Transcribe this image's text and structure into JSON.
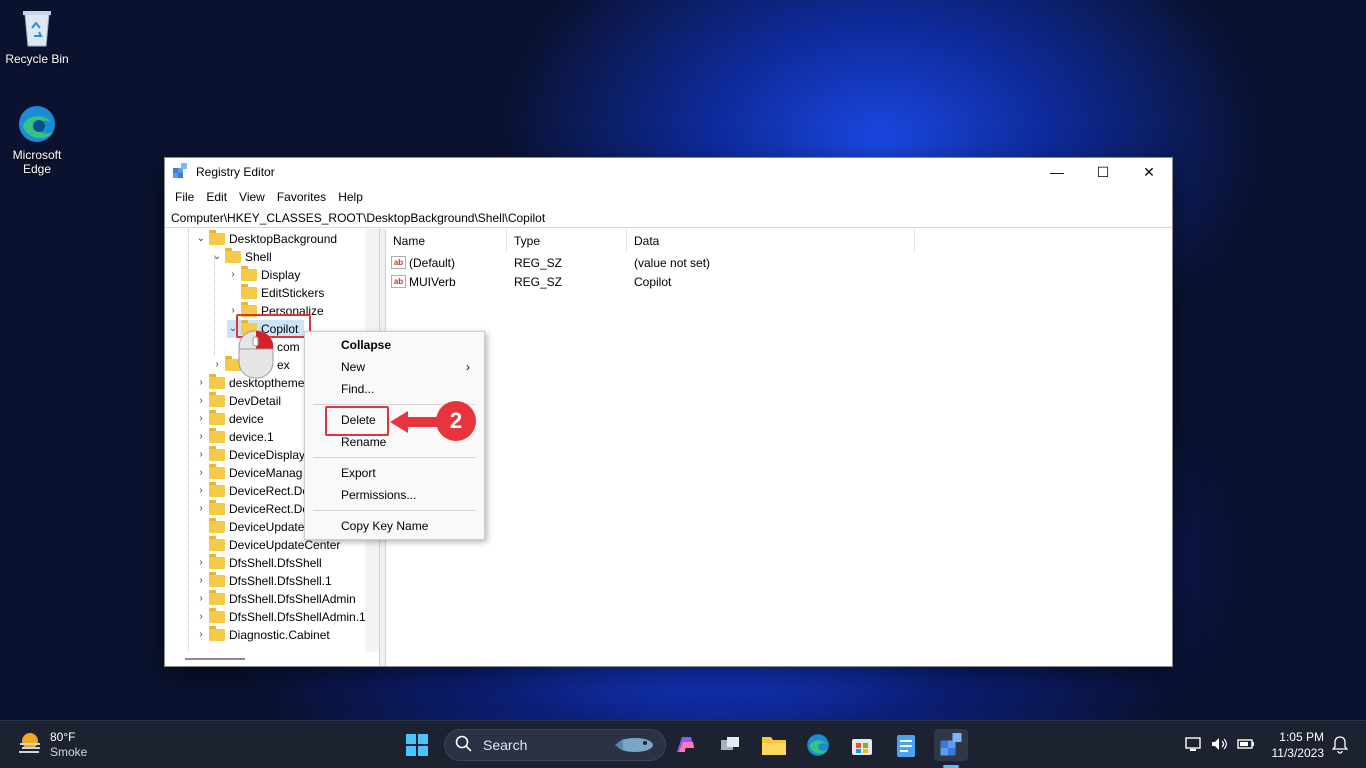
{
  "desktop": {
    "icons": [
      {
        "label": "Recycle Bin"
      },
      {
        "label": "Microsoft Edge"
      }
    ]
  },
  "window": {
    "title": "Registry Editor",
    "controls": {
      "minimize": "—",
      "maximize": "☐",
      "close": "✕"
    },
    "menu": [
      "File",
      "Edit",
      "View",
      "Favorites",
      "Help"
    ],
    "address": "Computer\\HKEY_CLASSES_ROOT\\DesktopBackground\\Shell\\Copilot"
  },
  "tree": {
    "nodes": [
      {
        "label": "DesktopBackground",
        "exp": "⌄"
      },
      {
        "label": "Shell",
        "exp": "⌄"
      },
      {
        "label": "Display",
        "exp": "›"
      },
      {
        "label": "EditStickers",
        "exp": ""
      },
      {
        "label": "Personalize",
        "exp": "›"
      },
      {
        "label": "Copilot",
        "exp": "⌄"
      },
      {
        "label": "com",
        "exp": ""
      },
      {
        "label": "ex",
        "exp": "›"
      },
      {
        "label": "desktopthemes",
        "exp": "›"
      },
      {
        "label": "DevDetail",
        "exp": "›"
      },
      {
        "label": "device",
        "exp": "›"
      },
      {
        "label": "device.1",
        "exp": "›"
      },
      {
        "label": "DeviceDisplay",
        "exp": "›"
      },
      {
        "label": "DeviceManag",
        "exp": "›"
      },
      {
        "label": "DeviceRect.De",
        "exp": "›"
      },
      {
        "label": "DeviceRect.De",
        "exp": "›"
      },
      {
        "label": "DeviceUpdate",
        "exp": ""
      },
      {
        "label": "DeviceUpdateCenter",
        "exp": ""
      },
      {
        "label": "DfsShell.DfsShell",
        "exp": "›"
      },
      {
        "label": "DfsShell.DfsShell.1",
        "exp": "›"
      },
      {
        "label": "DfsShell.DfsShellAdmin",
        "exp": "›"
      },
      {
        "label": "DfsShell.DfsShellAdmin.1",
        "exp": "›"
      },
      {
        "label": "Diagnostic.Cabinet",
        "exp": "›"
      }
    ]
  },
  "values": {
    "headers": [
      "Name",
      "Type",
      "Data"
    ],
    "rows": [
      {
        "name": "(Default)",
        "type": "REG_SZ",
        "data": "(value not set)"
      },
      {
        "name": "MUIVerb",
        "type": "REG_SZ",
        "data": "Copilot"
      }
    ],
    "icon_text": "ab"
  },
  "context_menu": {
    "items": [
      {
        "label": "Collapse",
        "bold": true
      },
      {
        "label": "New",
        "submenu": "›"
      },
      {
        "label": "Find..."
      },
      {
        "label": "Delete"
      },
      {
        "label": "Rename"
      },
      {
        "label": "Export"
      },
      {
        "label": "Permissions..."
      },
      {
        "label": "Copy Key Name"
      }
    ]
  },
  "annotation": {
    "step": "2",
    "color": "#e0343c"
  },
  "taskbar": {
    "weather": {
      "temp": "80°F",
      "condition": "Smoke"
    },
    "search_label": "Search",
    "clock": {
      "time": "1:05 PM",
      "date": "11/3/2023"
    },
    "pinned": [
      "start-icon",
      "copilot-icon",
      "task-view-icon",
      "file-explorer-icon",
      "edge-icon",
      "store-icon",
      "notepad-icon",
      "registry-editor-icon"
    ]
  }
}
